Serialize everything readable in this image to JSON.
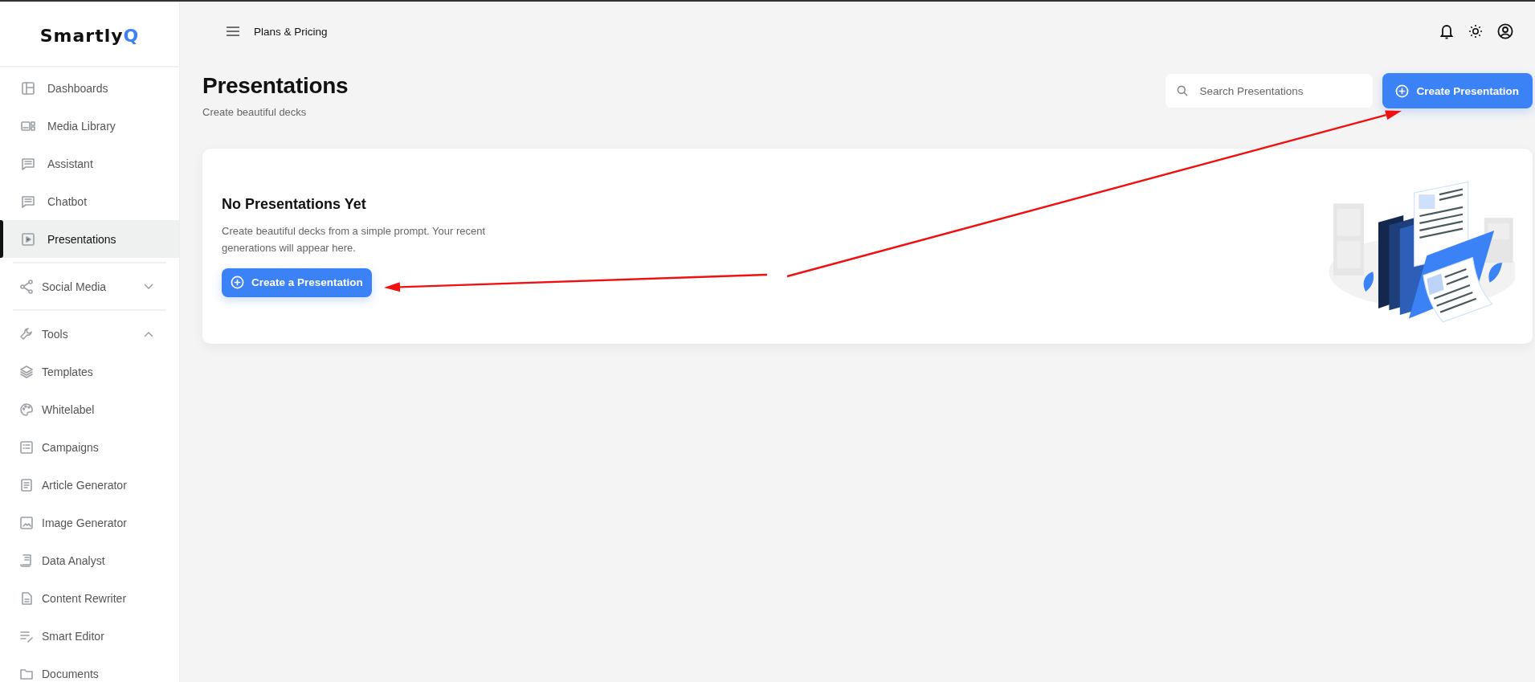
{
  "logo": {
    "text": "Smartly",
    "accent": "Q"
  },
  "sidebar": {
    "sections": [
      {
        "items": [
          {
            "label": "Dashboards",
            "selected": false
          },
          {
            "label": "Media Library",
            "selected": false
          },
          {
            "label": "Assistant",
            "selected": false
          },
          {
            "label": "Chatbot",
            "selected": false
          },
          {
            "label": "Presentations",
            "selected": true
          }
        ]
      },
      {
        "items": [
          {
            "label": "Social Media",
            "selected": false,
            "expanded": false
          }
        ]
      },
      {
        "items": [
          {
            "label": "Tools",
            "selected": false,
            "expanded": true,
            "children": [
              {
                "label": "Templates",
                "selected": false
              },
              {
                "label": "Whitelabel",
                "selected": false
              },
              {
                "label": "Campaigns",
                "selected": false
              },
              {
                "label": "Article Generator",
                "selected": false
              },
              {
                "label": "Image Generator",
                "selected": false
              },
              {
                "label": "Data Analyst",
                "selected": false
              },
              {
                "label": "Content Rewriter",
                "selected": false
              },
              {
                "label": "Smart Editor",
                "selected": false
              },
              {
                "label": "Documents",
                "selected": false
              }
            ]
          }
        ]
      }
    ]
  },
  "header": {
    "link": "Plans & Pricing"
  },
  "page": {
    "title": "Presentations",
    "subtitle": "Create beautiful decks",
    "search": {
      "placeholder": "Search Presentations"
    },
    "create_button": {
      "label": "Create Presentation"
    }
  },
  "empty_state": {
    "title": "No Presentations Yet",
    "description": "Create beautiful decks from a simple prompt. Your recent generations will appear here.",
    "button": {
      "label": "Create a Presentation"
    }
  },
  "annotations": [
    {
      "kind": "arrow"
    },
    {
      "kind": "arrow"
    }
  ]
}
